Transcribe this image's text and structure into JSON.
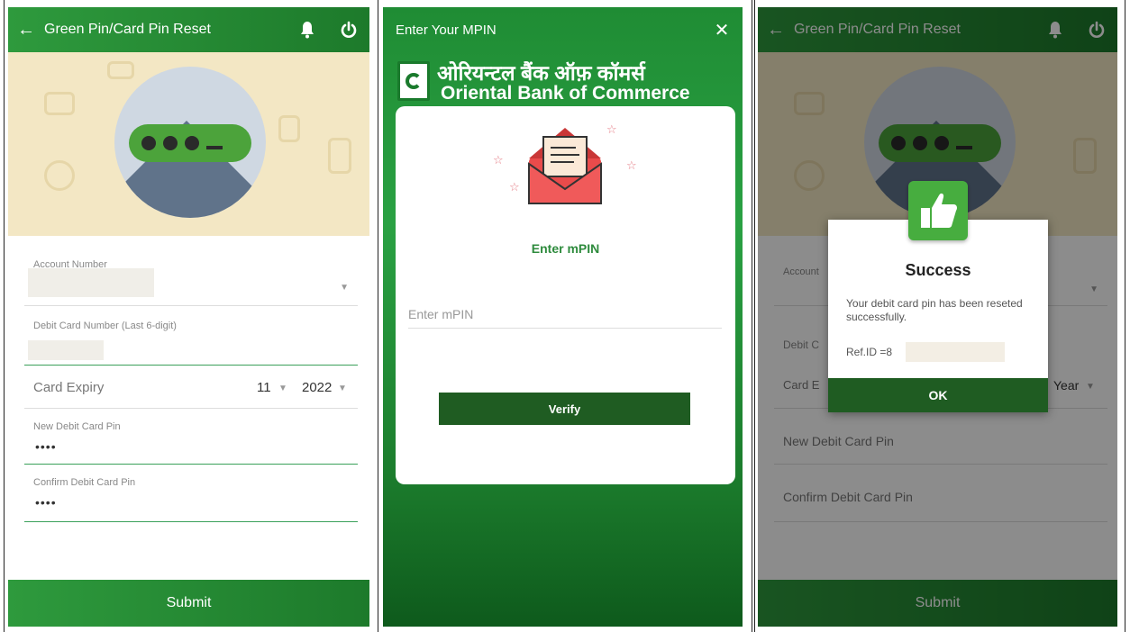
{
  "screens": {
    "reset": {
      "title": "Green Pin/Card Pin Reset",
      "back_icon": "arrow-left-icon",
      "bell_icon": "bell-icon",
      "power_icon": "power-icon",
      "account_label": "Account Number",
      "debit_label": "Debit Card Number (Last 6-digit)",
      "expiry_label": "Card Expiry",
      "expiry_month": "11",
      "expiry_year": "2022",
      "new_pin_label": "New Debit Card Pin",
      "new_pin_value": "••••",
      "confirm_pin_label": "Confirm Debit Card Pin",
      "confirm_pin_value": "••••",
      "submit_label": "Submit"
    },
    "mpin": {
      "title": "Enter Your MPIN",
      "close_icon": "close-icon",
      "bank_name_hindi": "ओरियन्टल बैंक ऑफ़ कॉमर्स",
      "bank_name_english": "Oriental Bank of Commerce",
      "heading": "Enter mPIN",
      "input_placeholder": "Enter mPIN",
      "verify_label": "Verify"
    },
    "success": {
      "title": "Green Pin/Card Pin Reset",
      "account_label": "Account",
      "debit_label": "Debit C",
      "expiry_label": "Card E",
      "year_label": "Year",
      "new_pin_label": "New Debit Card Pin",
      "confirm_pin_label": "Confirm Debit Card Pin",
      "submit_label": "Submit",
      "modal_title": "Success",
      "modal_message": "Your debit card pin has been reseted successfully.",
      "ref_label": "Ref.ID =8",
      "ok_label": "OK"
    }
  },
  "colors": {
    "primary_green": "#2e9a3d",
    "dark_green": "#1f5c22",
    "hero_bg": "#f3e7c4"
  }
}
